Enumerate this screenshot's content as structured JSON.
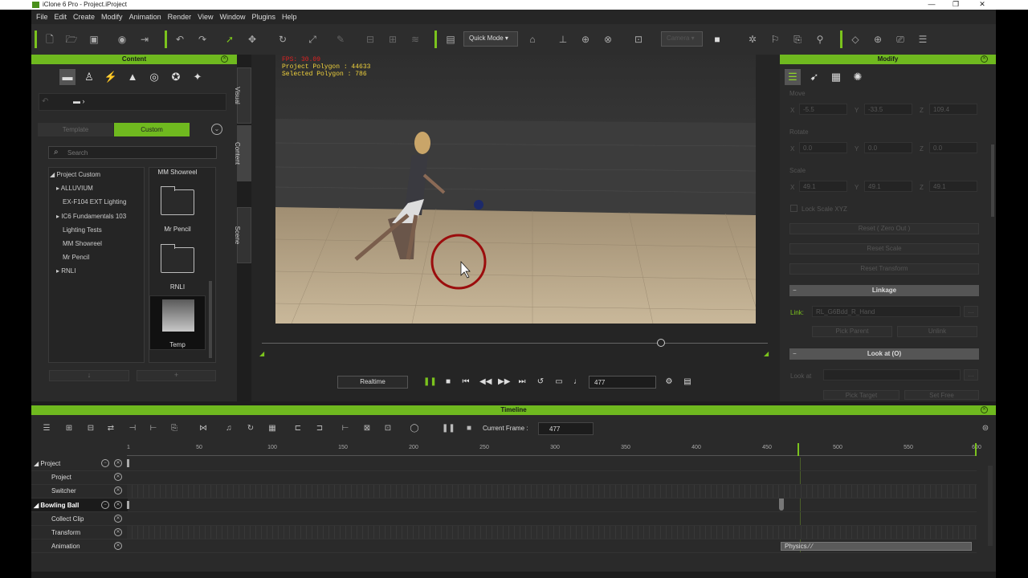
{
  "window": {
    "title": "iClone 6 Pro - Project.iProject"
  },
  "menu": [
    "File",
    "Edit",
    "Create",
    "Modify",
    "Animation",
    "Render",
    "View",
    "Window",
    "Plugins",
    "Help"
  ],
  "toolbar": {
    "mode": "Quick Mode",
    "camera": "Camera"
  },
  "content": {
    "header": "Content",
    "tab_template": "Template",
    "tab_custom": "Custom",
    "search_placeholder": "Search",
    "tree": [
      "Project Custom",
      "ALLUVIUM",
      "EX-F104 EXT Lighting",
      "IC6 Fundamentals 103",
      "Lighting Tests",
      "MM Showreel",
      "Mr Pencil",
      "RNLI"
    ],
    "thumbs": [
      "MM Showreel",
      "Mr Pencil",
      "RNLI",
      "Temp"
    ],
    "side_tabs": [
      "Visual",
      "Content",
      "Scene"
    ]
  },
  "viewport": {
    "fps": "FPS: 30.09",
    "polygons": "Project Polygon : 44633",
    "selected": "Selected Polygon : 786",
    "playback_mode": "Realtime",
    "frame": "477"
  },
  "modify": {
    "header": "Modify",
    "move_label": "Move",
    "move": {
      "x": "-5.5",
      "y": "-33.5",
      "z": "109.4"
    },
    "rotate_label": "Rotate",
    "rotate": {
      "x": "0.0",
      "y": "0.0",
      "z": "0.0"
    },
    "scale_label": "Scale",
    "scale": {
      "x": "49.1",
      "y": "49.1",
      "z": "49.1"
    },
    "lock_scale": "Lock Scale XYZ",
    "reset_zero": "Reset ( Zero Out )",
    "reset_scale": "Reset Scale",
    "reset_transform": "Reset Transform",
    "linkage": "Linkage",
    "link_label": "Link:",
    "link_value": "RL_G6Bdd_R_Hand",
    "pick_parent": "Pick Parent",
    "unlink": "Unlink",
    "look_at_section": "Look at  (O)",
    "look_at_label": "Look at",
    "pick_target": "Pick Target",
    "set_free": "Set Free"
  },
  "timeline": {
    "header": "Timeline",
    "current_frame_label": "Current Frame :",
    "current_frame": "477",
    "ticks": [
      "1",
      "50",
      "100",
      "150",
      "200",
      "250",
      "300",
      "350",
      "400",
      "450",
      "500",
      "550",
      "600"
    ],
    "tracks": [
      {
        "label": "Project",
        "group": true
      },
      {
        "label": "Project",
        "group": false
      },
      {
        "label": "Switcher",
        "group": false
      },
      {
        "label": "Bowling Ball",
        "group": true
      },
      {
        "label": "Collect Clip",
        "group": false
      },
      {
        "label": "Transform",
        "group": false
      },
      {
        "label": "Animation",
        "group": false
      }
    ],
    "physics_clip": "Physics"
  }
}
